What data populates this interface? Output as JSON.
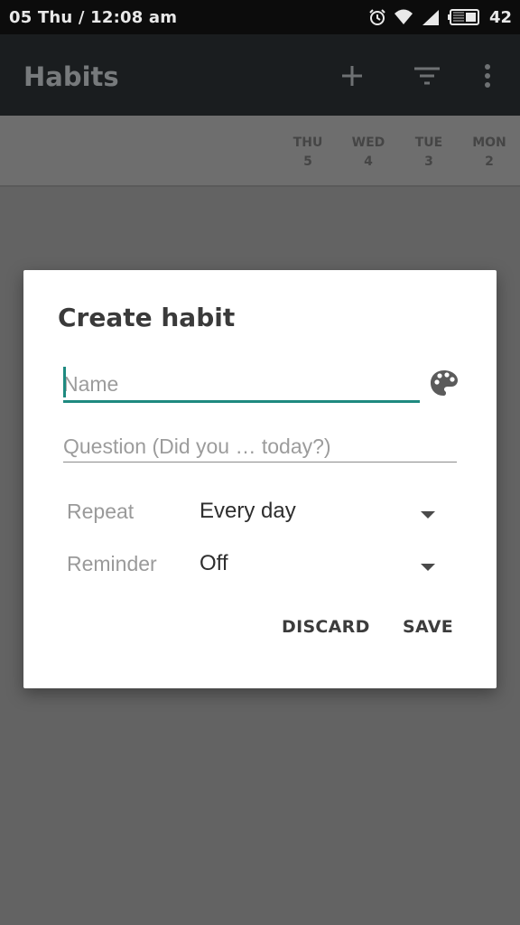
{
  "status_bar": {
    "time": "05 Thu  /  12:08 am",
    "battery_level": "42",
    "icons": [
      "alarm-icon",
      "wifi-icon",
      "signal-icon",
      "battery-icon"
    ]
  },
  "app_bar": {
    "title": "Habits",
    "actions": [
      "add-icon",
      "filter-icon",
      "more-icon"
    ]
  },
  "day_header": [
    {
      "day": "THU",
      "date": "5"
    },
    {
      "day": "WED",
      "date": "4"
    },
    {
      "day": "TUE",
      "date": "3"
    },
    {
      "day": "MON",
      "date": "2"
    }
  ],
  "dialog": {
    "title": "Create habit",
    "name_placeholder": "Name",
    "question_placeholder": "Question (Did you … today?)",
    "repeat_label": "Repeat",
    "repeat_value": "Every day",
    "reminder_label": "Reminder",
    "reminder_value": "Off",
    "discard_label": "DISCARD",
    "save_label": "SAVE"
  },
  "colors": {
    "accent": "#1e8a80",
    "scrim": "#636363",
    "appbar": "#1a1d1f",
    "statusbar": "#0c0c0c"
  }
}
